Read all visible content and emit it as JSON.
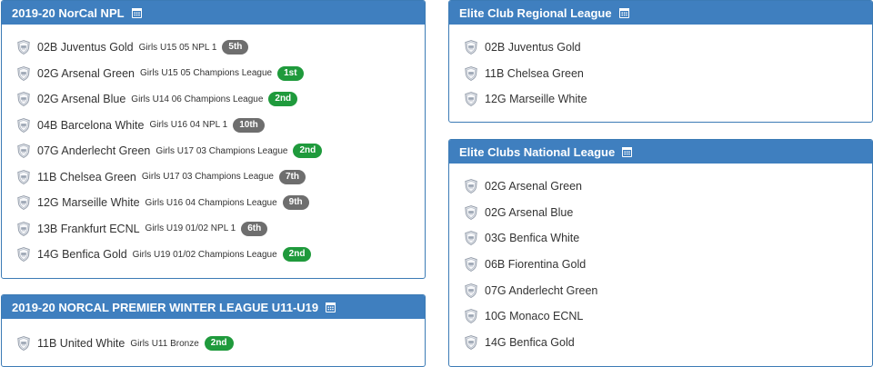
{
  "colors": {
    "header_bg": "#3f7fbf",
    "border": "#3c7bb5",
    "badge_green": "#1f9a3c",
    "badge_gray": "#6e6e6e"
  },
  "panels": {
    "npl": {
      "title": "2019-20 NorCal NPL",
      "icon": "calendar-icon",
      "rows": [
        {
          "team": "02B Juventus Gold",
          "division": "Girls U15 05 NPL 1",
          "place": "5th",
          "badge": "gray"
        },
        {
          "team": "02G Arsenal Green",
          "division": "Girls U15 05 Champions League",
          "place": "1st",
          "badge": "green"
        },
        {
          "team": "02G Arsenal Blue",
          "division": "Girls U14 06 Champions League",
          "place": "2nd",
          "badge": "green"
        },
        {
          "team": "04B Barcelona White",
          "division": "Girls U16 04 NPL 1",
          "place": "10th",
          "badge": "gray"
        },
        {
          "team": "07G Anderlecht Green",
          "division": "Girls U17 03 Champions League",
          "place": "2nd",
          "badge": "green"
        },
        {
          "team": "11B Chelsea Green",
          "division": "Girls U17 03 Champions League",
          "place": "7th",
          "badge": "gray"
        },
        {
          "team": "12G Marseille White",
          "division": "Girls U16 04 Champions League",
          "place": "9th",
          "badge": "gray"
        },
        {
          "team": "13B Frankfurt ECNL",
          "division": "Girls U19 01/02 NPL 1",
          "place": "6th",
          "badge": "gray"
        },
        {
          "team": "14G Benfica Gold",
          "division": "Girls U19 01/02 Champions League",
          "place": "2nd",
          "badge": "green"
        }
      ]
    },
    "winter": {
      "title": "2019-20 NORCAL PREMIER WINTER LEAGUE U11-U19",
      "icon": "calendar-icon",
      "rows": [
        {
          "team": "11B United White",
          "division": "Girls U11 Bronze",
          "place": "2nd",
          "badge": "green"
        }
      ]
    },
    "regional": {
      "title": "Elite Club Regional League",
      "icon": "calendar-icon",
      "rows": [
        {
          "team": "02B Juventus Gold"
        },
        {
          "team": "11B Chelsea Green"
        },
        {
          "team": "12G Marseille White"
        }
      ]
    },
    "national": {
      "title": "Elite Clubs National League",
      "icon": "calendar-icon",
      "rows": [
        {
          "team": "02G Arsenal Green"
        },
        {
          "team": "02G Arsenal Blue"
        },
        {
          "team": "03G Benfica White"
        },
        {
          "team": "06B Fiorentina Gold"
        },
        {
          "team": "07G Anderlecht Green"
        },
        {
          "team": "10G Monaco ECNL"
        },
        {
          "team": "14G Benfica Gold"
        }
      ]
    }
  }
}
